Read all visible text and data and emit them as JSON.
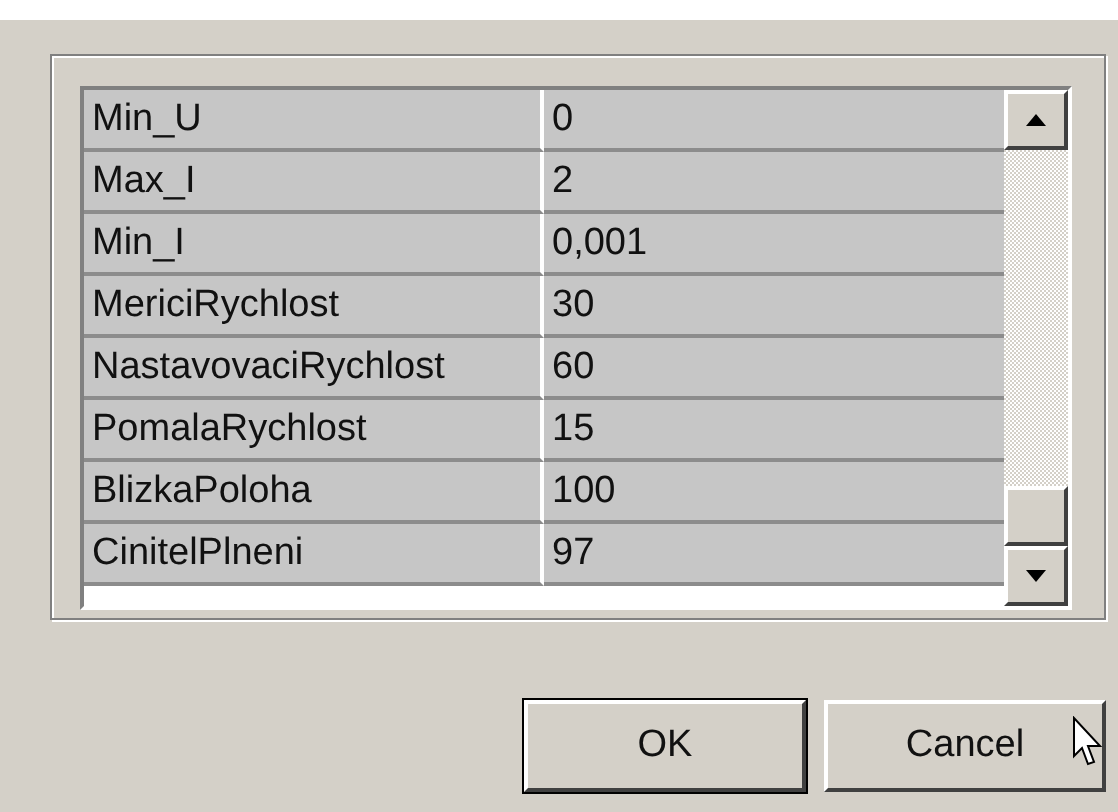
{
  "grid": {
    "rows": [
      {
        "name": "Min_U",
        "value": "0"
      },
      {
        "name": "Max_I",
        "value": "2"
      },
      {
        "name": "Min_I",
        "value": "0,001"
      },
      {
        "name": "MericiRychlost",
        "value": "30"
      },
      {
        "name": "NastavovaciRychlost",
        "value": "60"
      },
      {
        "name": "PomalaRychlost",
        "value": "15"
      },
      {
        "name": "BlizkaPoloha",
        "value": "100"
      },
      {
        "name": "CinitelPlneni",
        "value": "97"
      }
    ]
  },
  "buttons": [
    {
      "label": "OK",
      "default": true
    },
    {
      "label": "Cancel",
      "default": false
    }
  ]
}
